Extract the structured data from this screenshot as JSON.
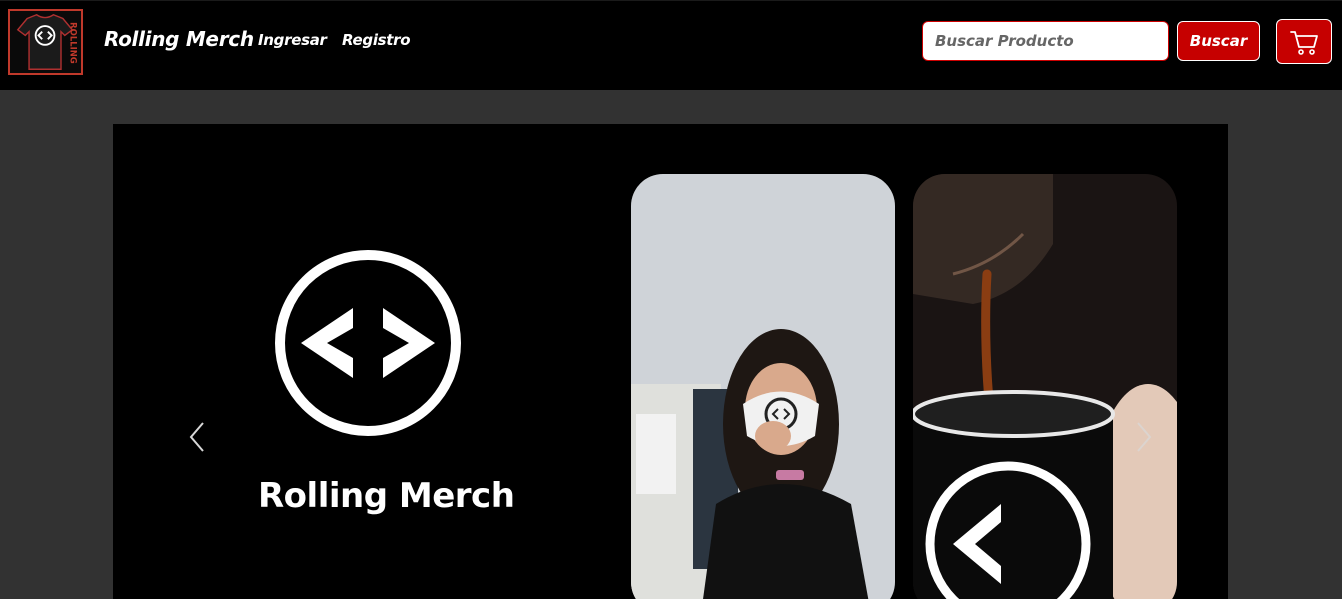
{
  "navbar": {
    "brand": "Rolling Merch",
    "links": {
      "login": "Ingresar",
      "register": "Registro"
    },
    "search": {
      "placeholder": "Buscar Producto",
      "button_label": "Buscar"
    },
    "cart_icon": "shopping-cart-icon",
    "logo_text": "ROLLING"
  },
  "carousel": {
    "slide_caption": "Rolling Merch",
    "controls": {
      "prev_icon": "chevron-left-icon",
      "next_icon": "chevron-right-icon"
    }
  },
  "colors": {
    "accent": "#c60000",
    "navbar_bg": "#000000",
    "page_bg": "#323232"
  }
}
